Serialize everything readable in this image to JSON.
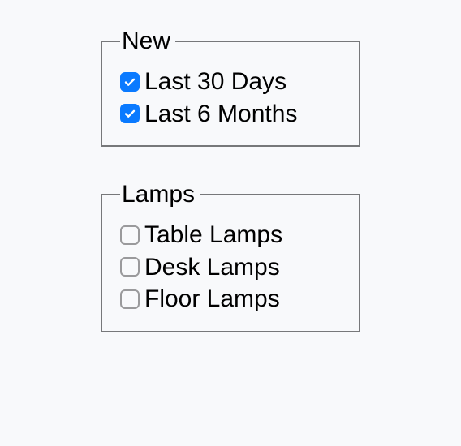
{
  "groups": [
    {
      "legend": "New",
      "items": [
        {
          "label": "Last 30 Days",
          "checked": true
        },
        {
          "label": "Last 6 Months",
          "checked": true
        }
      ]
    },
    {
      "legend": "Lamps",
      "items": [
        {
          "label": "Table Lamps",
          "checked": false
        },
        {
          "label": "Desk Lamps",
          "checked": false
        },
        {
          "label": "Floor Lamps",
          "checked": false
        }
      ]
    }
  ]
}
